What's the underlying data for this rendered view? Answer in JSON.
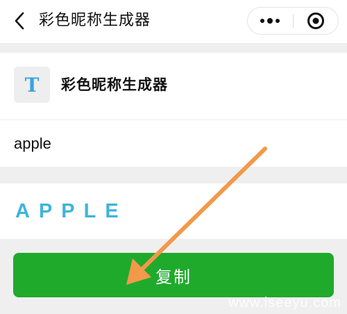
{
  "navbar": {
    "title": "彩色昵称生成器",
    "icons": {
      "back": "chevron-left-icon",
      "more": "more-dots-icon",
      "close": "target-circle-icon"
    }
  },
  "header": {
    "icon_letter": "T",
    "app_name": "彩色昵称生成器"
  },
  "input": {
    "value": "apple"
  },
  "result": {
    "styled_text": "APPLE"
  },
  "actions": {
    "copy_label": "复制"
  },
  "colors": {
    "accent_green": "#1faa2c",
    "result_blue": "#3fb4dc",
    "icon_blue": "#3aa3e0",
    "arrow_orange": "#f2994a"
  },
  "watermark": {
    "text": "www.iseeyu.com"
  }
}
